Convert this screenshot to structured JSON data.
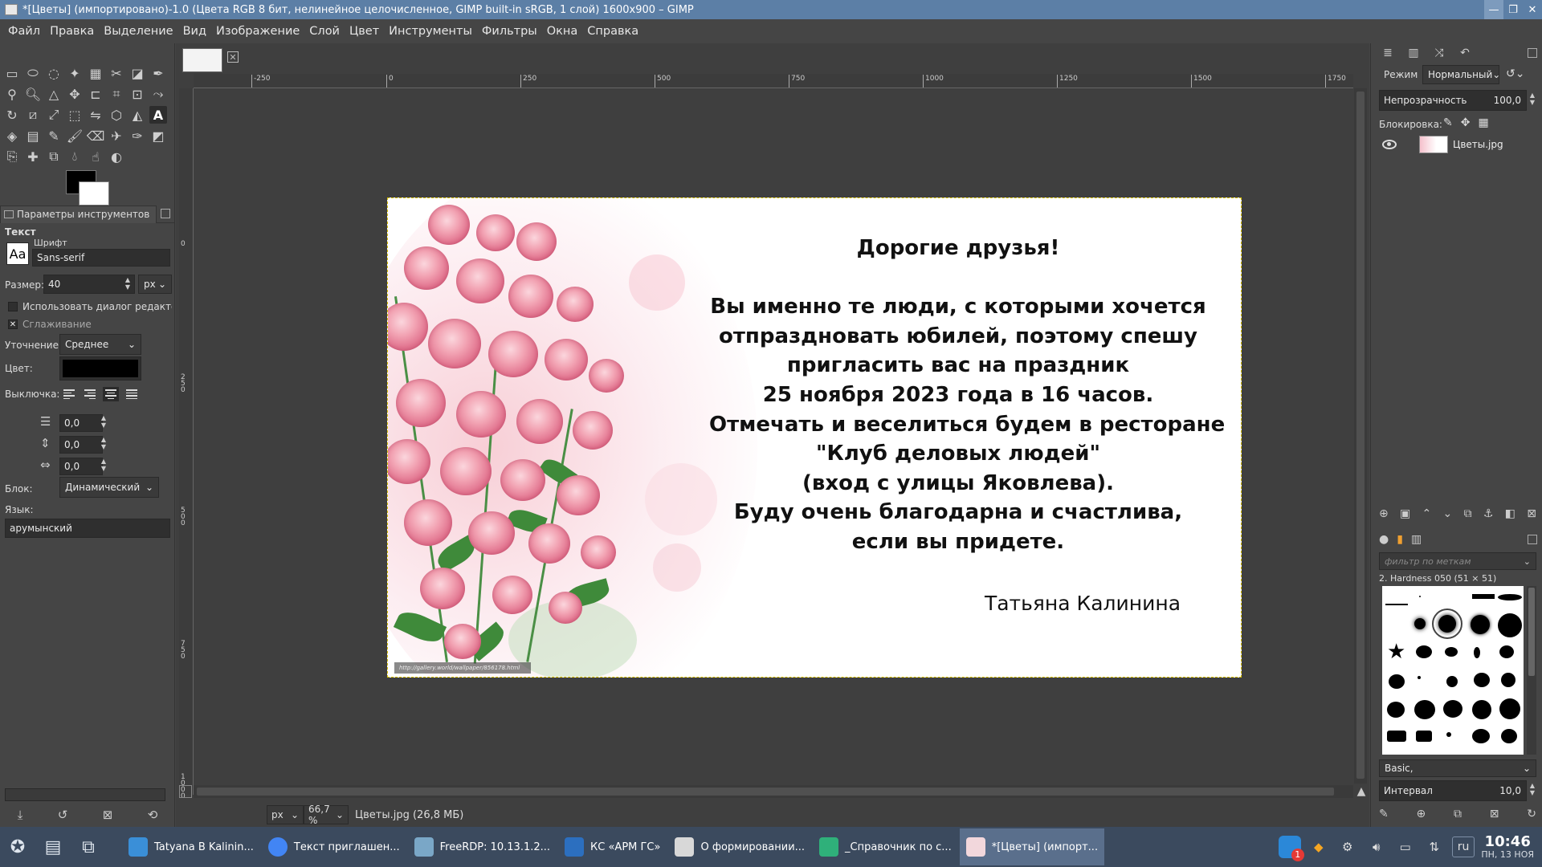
{
  "window": {
    "title": "*[Цветы] (импортировано)-1.0 (Цвета RGB 8 бит, нелинейное целочисленное, GIMP built-in sRGB, 1 слой) 1600x900 – GIMP"
  },
  "menu": [
    "Файл",
    "Правка",
    "Выделение",
    "Вид",
    "Изображение",
    "Слой",
    "Цвет",
    "Инструменты",
    "Фильтры",
    "Окна",
    "Справка"
  ],
  "tool_options": {
    "tab_label": "Параметры инструментов",
    "section_title": "Текст",
    "font_label": "Шрифт",
    "font_value": "Sans-serif",
    "font_preview": "Aa",
    "size_label": "Размер:",
    "size_value": "40",
    "size_unit": "px",
    "use_editor_label": "Использовать диалог редактора",
    "antialias_label": "Сглаживание",
    "antialias_checked": "✕",
    "hinting_label": "Уточнение:",
    "hinting_value": "Среднее",
    "color_label": "Цвет:",
    "justify_label": "Выключка:",
    "indent_value": "0,0",
    "line_spacing_value": "0,0",
    "letter_spacing_value": "0,0",
    "box_label": "Блок:",
    "box_value": "Динамический",
    "language_label": "Язык:",
    "language_value": "арумынский"
  },
  "ruler": {
    "h_labels": [
      "-250",
      "0",
      "250",
      "500",
      "750",
      "1000",
      "1250",
      "1500",
      "1750"
    ],
    "v_labels": [
      "0",
      "250",
      "500",
      "750",
      "1000"
    ]
  },
  "status": {
    "unit": "px",
    "zoom": "66,7 %",
    "text": "Цветы.jpg (26,8 МБ)"
  },
  "invitation": {
    "lines": [
      "Дорогие друзья!",
      "",
      "Вы именно те люди, с которыми хочется",
      "отпраздновать юбилей, поэтому спешу",
      "пригласить вас на праздник",
      "25 ноября 2023 года  в 16 часов.",
      "Отмечать и веселиться будем в ресторане",
      "\"Клуб деловых людей\"",
      "(вход с улицы Яковлева).",
      "Буду очень благодарна и счастлива,",
      "если вы придете."
    ],
    "signature": "Татьяна Калинина",
    "watermark": "http://gallery.world/wallpaper/856178.html"
  },
  "layers": {
    "mode_label": "Режим",
    "mode_value": "Нормальный",
    "opacity_label": "Непрозрачность",
    "opacity_value": "100,0",
    "lock_label": "Блокировка:",
    "layer_name": "Цветы.jpg"
  },
  "brushes": {
    "filter_placeholder": "фильтр по меткам",
    "brush_name": "2. Hardness 050 (51 × 51)",
    "preset": "Basic,",
    "spacing_label": "Интервал",
    "spacing_value": "10,0"
  },
  "taskbar": {
    "tasks": [
      {
        "label": "Tatyana B Kalinin...",
        "color": "#3a8fd8"
      },
      {
        "label": "Текст приглашен...",
        "color": "#4285f4"
      },
      {
        "label": "FreeRDP: 10.13.1.2...",
        "color": "#7aa7c7"
      },
      {
        "label": "КС «АРМ ГС»",
        "color": "#2c6fbf"
      },
      {
        "label": "О формировании...",
        "color": "#d8d8d8"
      },
      {
        "label": "_Справочник по с...",
        "color": "#2fb07a"
      },
      {
        "label": "*[Цветы] (импорт...",
        "color": "#f2d7dc"
      }
    ],
    "notification_count": "1",
    "lang": "ru",
    "time": "10:46",
    "date": "ПН, 13 НОЯ"
  }
}
